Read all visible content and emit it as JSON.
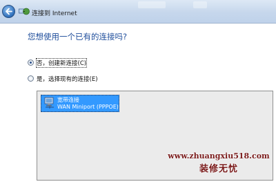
{
  "window": {
    "title": "连接到 Internet"
  },
  "dialog": {
    "question": "您想使用一个已有的连接吗?",
    "options": [
      {
        "label": "否，创建新连接(C)",
        "checked": true
      },
      {
        "label": "是，选择现有的连接(E)",
        "checked": false
      }
    ],
    "connections": [
      {
        "name": "宽带连接",
        "device": "WAN Miniport (PPPOE)",
        "selected": true
      }
    ]
  },
  "watermark": {
    "url": "www.zhuangxiu518.com",
    "slogan": "装修无忧"
  },
  "colors": {
    "question_text": "#1e4d9b",
    "selection": "#3399ff",
    "list_background": "#ebebeb",
    "watermark": "#7a1b1b"
  },
  "icons": {
    "back": "back-arrow-icon",
    "window": "network-globe-icon",
    "connection": "network-computer-icon"
  }
}
